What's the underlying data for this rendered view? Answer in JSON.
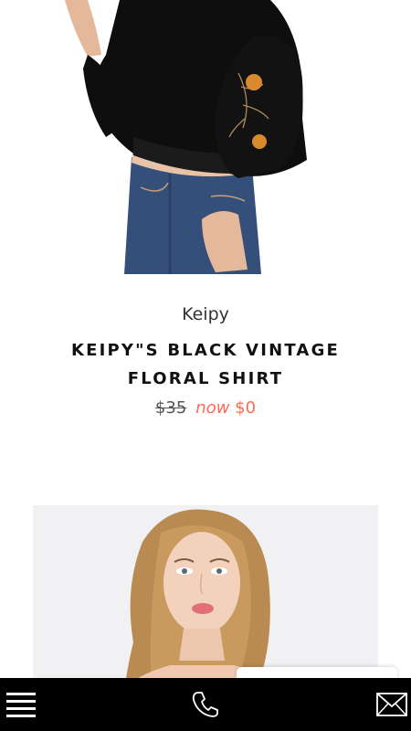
{
  "products": [
    {
      "brand": "Keipy",
      "title": "KEIPY\"S BLACK VINTAGE FLORAL SHIRT",
      "price_old": "$35",
      "price_now_label": "now",
      "price_new": "$0"
    }
  ],
  "colors": {
    "sale_price": "#ff6a52",
    "bottom_bar": "#000000"
  },
  "bottom_bar": {
    "icons": [
      "menu-icon",
      "phone-icon",
      "mail-icon"
    ]
  }
}
